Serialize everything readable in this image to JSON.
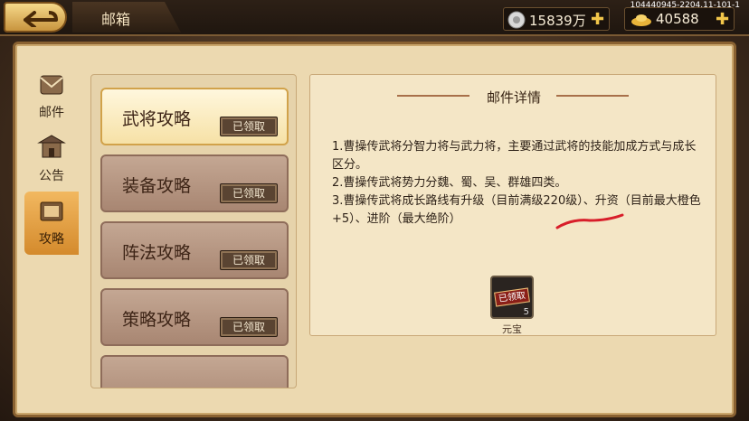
{
  "header": {
    "title": "邮箱",
    "silver_value": "15839万",
    "gold_value": "40588",
    "server_id": "104440945-2204.11-101-1"
  },
  "sidebar": {
    "tabs": [
      {
        "label": "邮件",
        "icon": "scroll-icon"
      },
      {
        "label": "公告",
        "icon": "pavilion-icon"
      },
      {
        "label": "攻略",
        "icon": "book-icon"
      }
    ],
    "active_tab": "攻略"
  },
  "mail_list": {
    "items": [
      {
        "name": "武将攻略",
        "status": "已领取"
      },
      {
        "name": "装备攻略",
        "status": "已领取"
      },
      {
        "name": "阵法攻略",
        "status": "已领取"
      },
      {
        "name": "策略攻略",
        "status": "已领取"
      }
    ],
    "selected": "武将攻略"
  },
  "detail": {
    "title": "邮件详情",
    "lines": [
      "1.曹操传武将分智力将与武力将，主要通过武将的技能加成方式与成长区分。",
      "2.曹操传武将势力分魏、蜀、吴、群雄四类。",
      "3.曹操传武将成长路线有升级（目前满级220级）、升资（目前最大橙色+5）、进阶（最大绝阶）"
    ],
    "attachment": {
      "badge": "已领取",
      "count": "5",
      "label": "元宝"
    }
  },
  "colors": {
    "accent": "#d48a2c",
    "frame": "#8a6232",
    "panel": "#f4e6c6",
    "mark": "#d81e2a"
  }
}
